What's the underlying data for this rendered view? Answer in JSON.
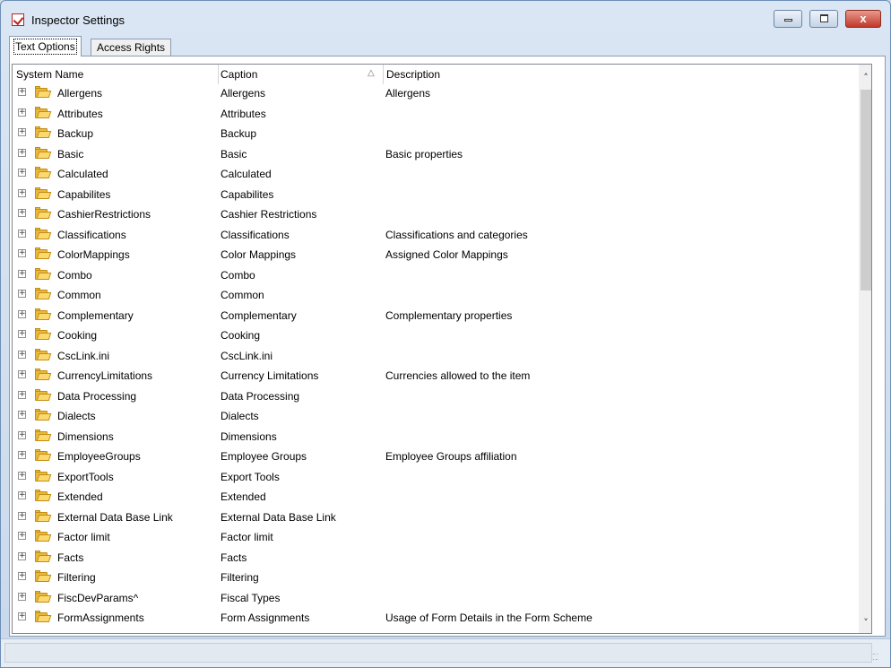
{
  "window": {
    "title": "Inspector Settings",
    "minimize_icon": "minimize-icon",
    "maximize_icon": "maximize-icon",
    "close_glyph": "x"
  },
  "tabs": [
    {
      "label": "Text Options"
    },
    {
      "label": "Access Rights"
    }
  ],
  "columns": {
    "system_name": "System Name",
    "caption": "Caption",
    "description": "Description"
  },
  "scroll": {
    "up_glyph": "˄",
    "down_glyph": "˅"
  },
  "expander_glyph": "+",
  "rows": [
    {
      "system": "Allergens",
      "caption": "Allergens",
      "description": "Allergens"
    },
    {
      "system": "Attributes",
      "caption": "Attributes",
      "description": ""
    },
    {
      "system": "Backup",
      "caption": "Backup",
      "description": ""
    },
    {
      "system": "Basic",
      "caption": "Basic",
      "description": "Basic properties"
    },
    {
      "system": "Calculated",
      "caption": "Calculated",
      "description": ""
    },
    {
      "system": "Capabilites",
      "caption": "Capabilites",
      "description": ""
    },
    {
      "system": "CashierRestrictions",
      "caption": "Cashier Restrictions",
      "description": ""
    },
    {
      "system": "Classifications",
      "caption": "Classifications",
      "description": "Classifications and categories"
    },
    {
      "system": "ColorMappings",
      "caption": "Color Mappings",
      "description": "Assigned Color Mappings"
    },
    {
      "system": "Combo",
      "caption": "Combo",
      "description": ""
    },
    {
      "system": "Common",
      "caption": "Common",
      "description": ""
    },
    {
      "system": "Complementary",
      "caption": "Complementary",
      "description": "Complementary properties"
    },
    {
      "system": "Cooking",
      "caption": "Cooking",
      "description": ""
    },
    {
      "system": "CscLink.ini",
      "caption": "CscLink.ini",
      "description": ""
    },
    {
      "system": "CurrencyLimitations",
      "caption": "Currency Limitations",
      "description": "Currencies allowed to the item"
    },
    {
      "system": "Data Processing",
      "caption": "Data Processing",
      "description": ""
    },
    {
      "system": "Dialects",
      "caption": "Dialects",
      "description": ""
    },
    {
      "system": "Dimensions",
      "caption": "Dimensions",
      "description": ""
    },
    {
      "system": "EmployeeGroups",
      "caption": "Employee Groups",
      "description": "Employee Groups affiliation"
    },
    {
      "system": "ExportTools",
      "caption": "Export Tools",
      "description": ""
    },
    {
      "system": "Extended",
      "caption": "Extended",
      "description": ""
    },
    {
      "system": "External Data Base Link",
      "caption": "External Data Base Link",
      "description": ""
    },
    {
      "system": "Factor limit",
      "caption": "Factor limit",
      "description": ""
    },
    {
      "system": "Facts",
      "caption": "Facts",
      "description": ""
    },
    {
      "system": "Filtering",
      "caption": "Filtering",
      "description": ""
    },
    {
      "system": "FiscDevParams^",
      "caption": "Fiscal Types",
      "description": ""
    },
    {
      "system": "FormAssignments",
      "caption": "Form Assignments",
      "description": "Usage of Form Details in the Form Scheme"
    }
  ]
}
